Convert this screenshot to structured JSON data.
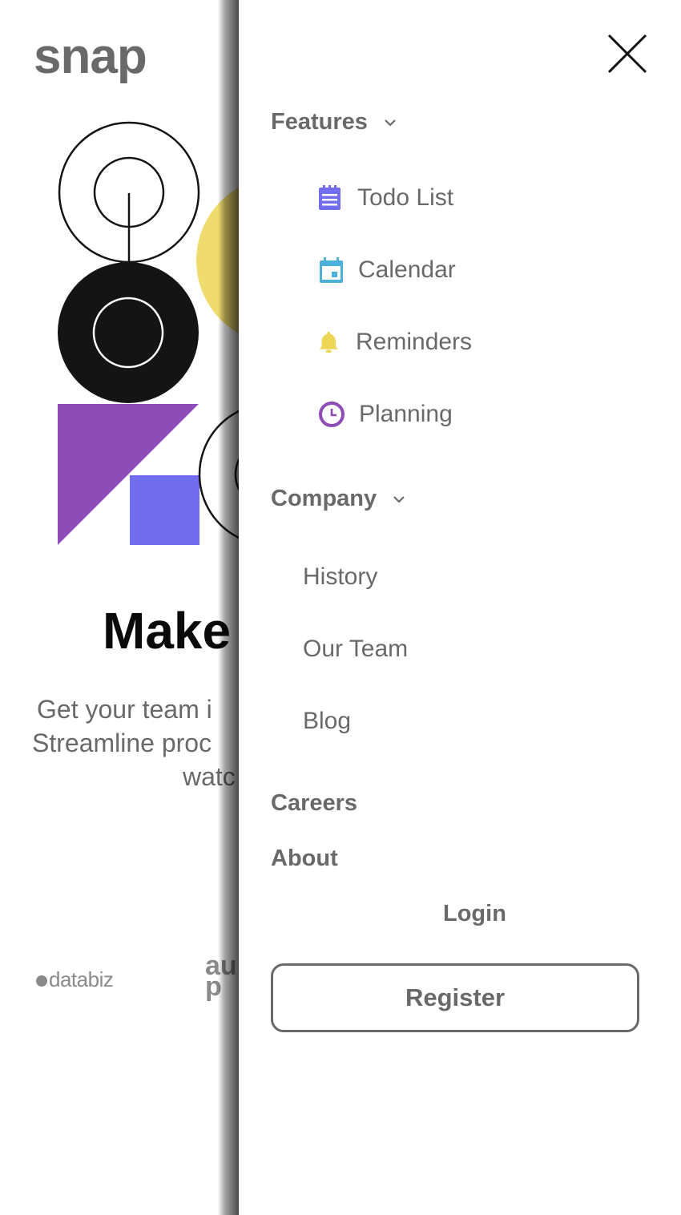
{
  "page": {
    "logo": "snap",
    "hero_title": "Make",
    "hero_desc_lines": [
      "Get your team i",
      "Streamline proc",
      "watc"
    ],
    "clients": {
      "databiz": "databiz",
      "second_partial": "au\np"
    }
  },
  "drawer": {
    "features_label": "Features",
    "features_items": [
      {
        "label": "Todo List",
        "icon": "todo-list-icon",
        "color": "#726CEE"
      },
      {
        "label": "Calendar",
        "icon": "calendar-icon",
        "color": "#4BB1DA"
      },
      {
        "label": "Reminders",
        "icon": "bell-icon",
        "color": "#EDD556"
      },
      {
        "label": "Planning",
        "icon": "clock-icon",
        "color": "#8E4CB6"
      }
    ],
    "company_label": "Company",
    "company_items": [
      {
        "label": "History"
      },
      {
        "label": "Our Team"
      },
      {
        "label": "Blog"
      }
    ],
    "careers_label": "Careers",
    "about_label": "About",
    "login_label": "Login",
    "register_label": "Register"
  },
  "colors": {
    "text_gray": "#696969",
    "purple": "#8E4CB6",
    "blue_violet": "#726CEE",
    "yellow": "#EDD556",
    "black": "#141414"
  }
}
